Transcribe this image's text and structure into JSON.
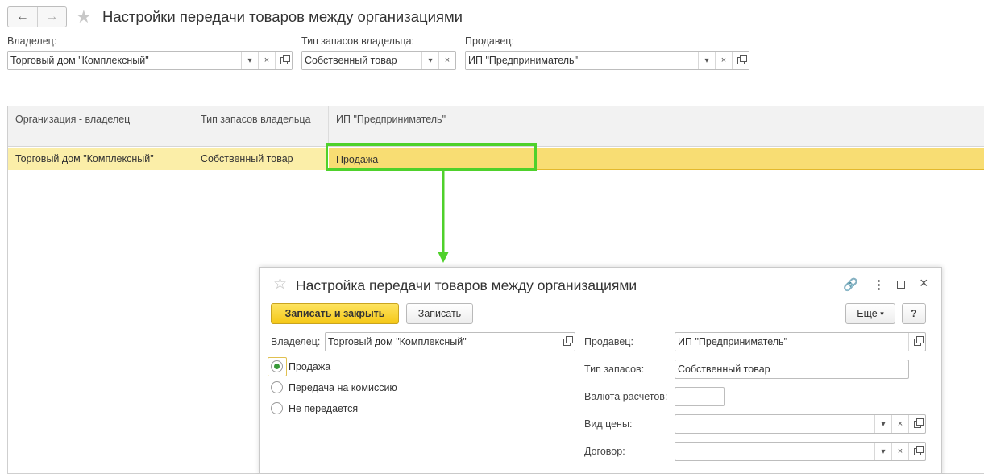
{
  "toolbar": {
    "back_icon": "arrow-left-icon",
    "forward_icon": "arrow-right-icon",
    "favorite_icon": "star-icon",
    "title": "Настройки передачи товаров между организациями"
  },
  "filters": {
    "owner_label": "Владелец:",
    "owner_value": "Торговый дом \"Комплексный\"",
    "stock_type_label": "Тип запасов владельца:",
    "stock_type_value": "Собственный товар",
    "seller_label": "Продавец:",
    "seller_value": "ИП \"Предприниматель\""
  },
  "table": {
    "columns": [
      "Организация - владелец",
      "Тип запасов владельца",
      "ИП \"Предприниматель\""
    ],
    "rows": [
      [
        "Торговый дом \"Комплексный\"",
        "Собственный товар",
        "Продажа"
      ]
    ]
  },
  "annotation": {
    "color": "#4fd12b"
  },
  "dialog": {
    "title": "Настройка передачи товаров между организациями",
    "save_close_label": "Записать и закрыть",
    "save_label": "Записать",
    "more_label": "Еще",
    "help_label": "?",
    "owner_label": "Владелец:",
    "owner_value": "Торговый дом \"Комплексный\"",
    "transfer_options": [
      "Продажа",
      "Передача на комиссию",
      "Не передается"
    ],
    "selected_option": "Продажа",
    "seller_label": "Продавец:",
    "seller_value": "ИП \"Предприниматель\"",
    "stock_type_label": "Тип запасов:",
    "stock_type_value": "Собственный товар",
    "currency_label": "Валюта расчетов:",
    "currency_value": "",
    "price_type_label": "Вид цены:",
    "price_type_value": "",
    "contract_label": "Договор:",
    "contract_value": ""
  },
  "colors": {
    "primary_button": "#f5c817",
    "selected_row": "#fbeea8",
    "selected_cell": "#f8dd73"
  }
}
